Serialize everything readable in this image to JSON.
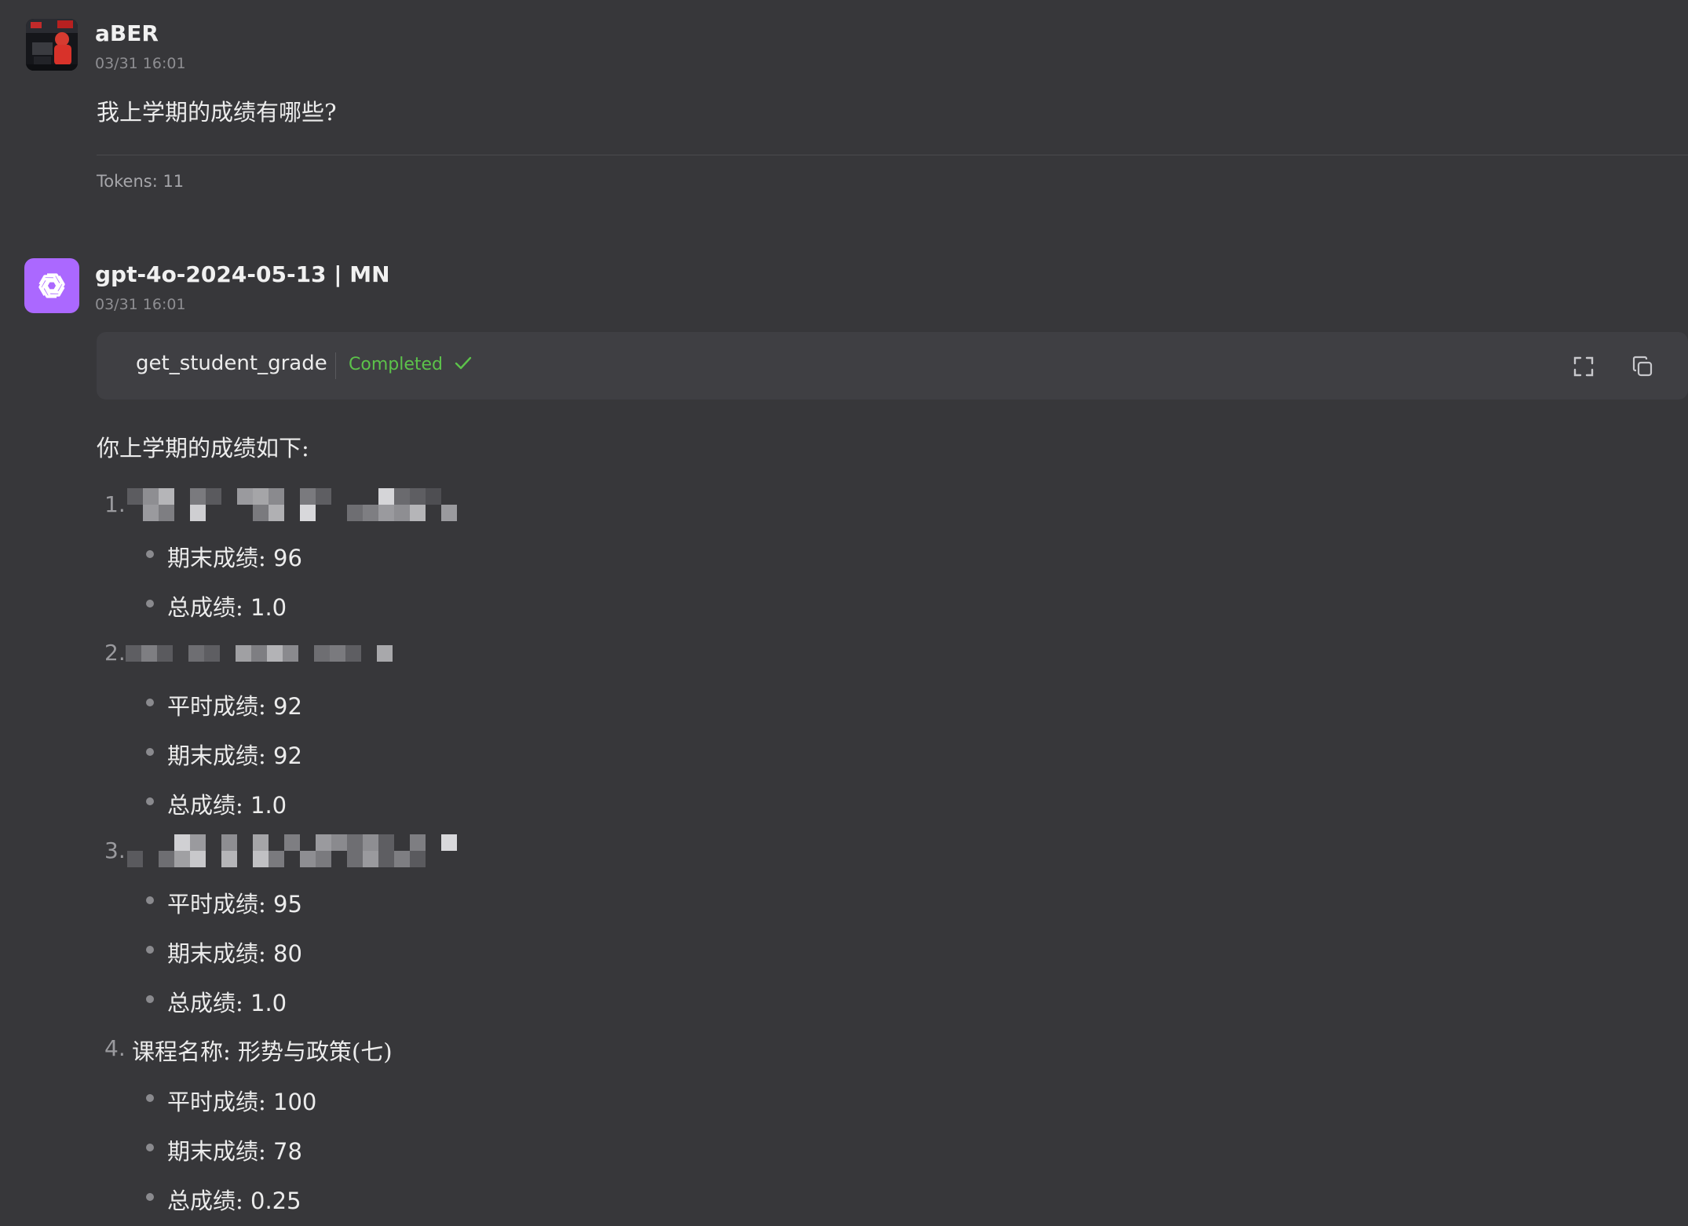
{
  "user_message": {
    "sender": "aBER",
    "time": "03/31 16:01",
    "text": "我上学期的成绩有哪些?",
    "tokens": "Tokens: 11"
  },
  "assistant_message": {
    "sender": "gpt-4o-2024-05-13 | MN",
    "time": "03/31 16:01",
    "tool_call": {
      "name": "get_student_grade",
      "status": "Completed",
      "status_icon": "check-icon",
      "actions": [
        "expand-icon",
        "copy-icon"
      ]
    },
    "intro": "你上学期的成绩如下:",
    "courses": [
      {
        "number": "1.",
        "title": "",
        "title_redacted": true,
        "grades": [
          {
            "label": "期末成绩: ",
            "value": "96"
          },
          {
            "label": "总成绩: ",
            "value": "1.0"
          }
        ]
      },
      {
        "number": "2.",
        "title": "",
        "title_redacted": true,
        "grades": [
          {
            "label": "平时成绩: ",
            "value": "92"
          },
          {
            "label": "期末成绩: ",
            "value": "92"
          },
          {
            "label": "总成绩: ",
            "value": "1.0"
          }
        ]
      },
      {
        "number": "3.",
        "title": "",
        "title_redacted": true,
        "grades": [
          {
            "label": "平时成绩: ",
            "value": "95"
          },
          {
            "label": "期末成绩: ",
            "value": "80"
          },
          {
            "label": "总成绩: ",
            "value": "1.0"
          }
        ]
      },
      {
        "number": "4.",
        "title": "课程名称: 形势与政策(七)",
        "title_redacted": false,
        "grades": [
          {
            "label": "平时成绩: ",
            "value": "100"
          },
          {
            "label": "期末成绩: ",
            "value": "78"
          },
          {
            "label": "总成绩: ",
            "value": "0.25"
          }
        ]
      }
    ]
  },
  "colors": {
    "background": "#37373a",
    "tool_card": "#3f3f43",
    "status_green": "#5cc24a",
    "ai_avatar": "#ab68ff"
  }
}
